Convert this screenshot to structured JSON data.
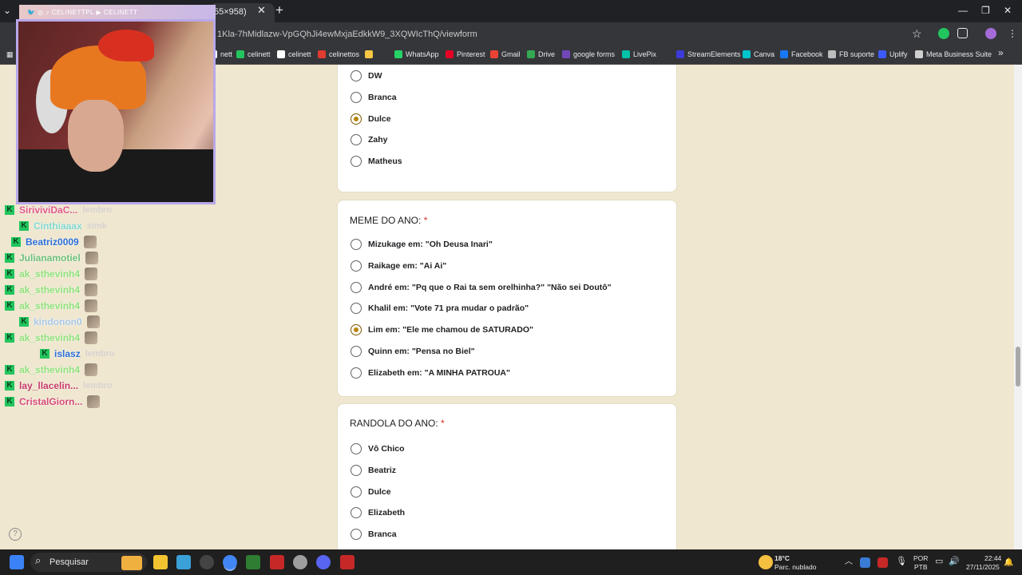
{
  "browser": {
    "tab_title": "55×958)",
    "url": "1Kla-7hMidlazw-VpGQhJi4ewMxjaEdkkW9_3XQWIcThQ/viewform",
    "window_controls": [
      "—",
      "❐",
      "✕"
    ],
    "bookmarks": [
      {
        "label": "nett",
        "color": "#ffffff"
      },
      {
        "label": "celinett",
        "color": "#22c55e"
      },
      {
        "label": "celinett",
        "color": "#ffffff"
      },
      {
        "label": "celinettos",
        "color": "#e03c31"
      },
      {
        "label": "",
        "color": "#f6c744"
      },
      {
        "label": "WhatsApp",
        "color": "#25d366"
      },
      {
        "label": "Pinterest",
        "color": "#e60023"
      },
      {
        "label": "Gmail",
        "color": "#ea4335"
      },
      {
        "label": "Drive",
        "color": "#34a853"
      },
      {
        "label": "google forms",
        "color": "#7248b9"
      },
      {
        "label": "LivePix",
        "color": "#00c2a8"
      },
      {
        "label": "StreamElements",
        "color": "#3b3bd8"
      },
      {
        "label": "Canva",
        "color": "#00c4cc"
      },
      {
        "label": "Facebook",
        "color": "#1877f2"
      },
      {
        "label": "FB suporte",
        "color": "#bdbdbd"
      },
      {
        "label": "Uplify",
        "color": "#3d5afe"
      },
      {
        "label": "Meta Business Suite",
        "color": "#cfcfcf"
      }
    ]
  },
  "form": {
    "question1": {
      "options": [
        {
          "label": "DW",
          "selected": false
        },
        {
          "label": "Branca",
          "selected": false
        },
        {
          "label": "Dulce",
          "selected": true
        },
        {
          "label": "Zahy",
          "selected": false
        },
        {
          "label": "Matheus",
          "selected": false
        }
      ]
    },
    "question2": {
      "title": "MEME DO ANO:",
      "required_mark": "*",
      "options": [
        {
          "label": "Mizukage em: \"Oh Deusa Inari\"",
          "selected": false
        },
        {
          "label": "Raikage em: \"Ai Ai\"",
          "selected": false
        },
        {
          "label": "André em: \"Pq que o Rai ta sem orelhinha?\" \"Não sei Doutô\"",
          "selected": false
        },
        {
          "label": "Khalil em: \"Vote 71 pra mudar o padrão\"",
          "selected": false
        },
        {
          "label": "Lim em: \"Ele me chamou de SATURADO\"",
          "selected": true
        },
        {
          "label": "Quinn em: \"Pensa no Biel\"",
          "selected": false
        },
        {
          "label": "Elizabeth em: \"A MINHA PATROUA\"",
          "selected": false
        }
      ]
    },
    "question3": {
      "title": "RANDOLA DO ANO:",
      "required_mark": "*",
      "options": [
        {
          "label": "Vô Chico",
          "selected": false
        },
        {
          "label": "Beatriz",
          "selected": false
        },
        {
          "label": "Dulce",
          "selected": false
        },
        {
          "label": "Elizabeth",
          "selected": false
        },
        {
          "label": "Branca",
          "selected": false
        }
      ]
    }
  },
  "stream_overlay": {
    "header_text": "🐦 ◎ ♪ CELINETTPL  ▶ CELINETT",
    "chat": [
      {
        "name": "SiriviviDaC...",
        "color": "#e05a8a",
        "message": "lembro",
        "emote": false
      },
      {
        "name": "Cinthiaaax",
        "color": "#7fd8d0",
        "message": "simk",
        "emote": false
      },
      {
        "name": "Beatriz0009",
        "color": "#2d6fd8",
        "message": "",
        "emote": true
      },
      {
        "name": "Julianamotiel",
        "color": "#6cc07a",
        "message": "",
        "emote": true
      },
      {
        "name": "ak_sthevinh4",
        "color": "#8fe07a",
        "message": "",
        "emote": true
      },
      {
        "name": "ak_sthevinh4",
        "color": "#8fe07a",
        "message": "",
        "emote": true
      },
      {
        "name": "ak_sthevinh4",
        "color": "#8fe07a",
        "message": "",
        "emote": true
      },
      {
        "name": "kindonon0",
        "color": "#a8c8e8",
        "message": "",
        "emote": true
      },
      {
        "name": "ak_sthevinh4",
        "color": "#8fe07a",
        "message": "",
        "emote": true
      },
      {
        "name": "islasz",
        "color": "#2d6fd8",
        "message": "lembro",
        "emote": false
      },
      {
        "name": "ak_sthevinh4",
        "color": "#8fe07a",
        "message": "",
        "emote": true
      },
      {
        "name": "lay_llacelin...",
        "color": "#c83a6a",
        "message": "lembro",
        "emote": false
      },
      {
        "name": "CristalGiorn...",
        "color": "#d84a7a",
        "message": "",
        "emote": true
      }
    ]
  },
  "taskbar": {
    "search_placeholder": "Pesquisar",
    "weather_temp": "18°C",
    "weather_desc": "Parc. nublado",
    "lang1": "POR",
    "lang2": "PTB",
    "time": "22:44",
    "date": "27/11/2025"
  }
}
